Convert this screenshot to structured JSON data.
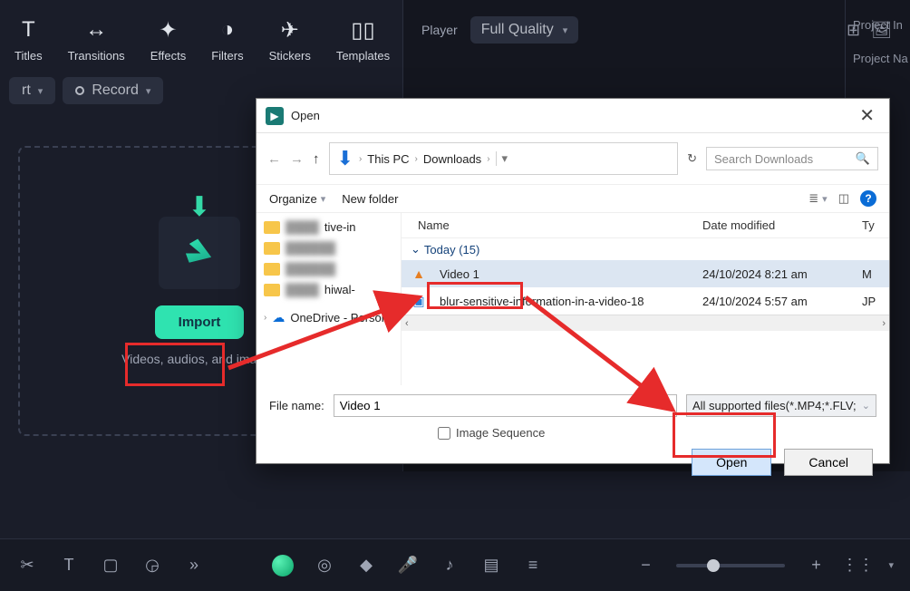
{
  "toolbar": {
    "items": [
      {
        "label": "Titles",
        "icon": "T"
      },
      {
        "label": "Transitions",
        "icon": "↔"
      },
      {
        "label": "Effects",
        "icon": "✦"
      },
      {
        "label": "Filters",
        "icon": "◑"
      },
      {
        "label": "Stickers",
        "icon": "✈"
      },
      {
        "label": "Templates",
        "icon": "▯▯"
      }
    ]
  },
  "recordbar": {
    "dropdown1": "rt",
    "record_label": "Record"
  },
  "dropzone": {
    "import_label": "Import",
    "hint": "Videos, audios, and images"
  },
  "preview": {
    "player_label": "Player",
    "quality": "Full Quality"
  },
  "sideprops": {
    "row1": "Project In",
    "row2": "Project Na"
  },
  "dialog": {
    "title": "Open",
    "crumbs": [
      "This PC",
      "Downloads"
    ],
    "search_placeholder": "Search Downloads",
    "organize": "Organize",
    "new_folder": "New folder",
    "col_name": "Name",
    "col_date": "Date modified",
    "col_type": "Ty",
    "tree": {
      "item1": "tive-in",
      "item5": "hiwal-",
      "onedrive": "OneDrive - Person"
    },
    "group": "Today (15)",
    "files": [
      {
        "icon": "vlc",
        "name": "Video 1",
        "date": "24/10/2024 8:21 am",
        "type": "M"
      },
      {
        "icon": "jpg",
        "name": "blur-sensitive-information-in-a-video-18",
        "date": "24/10/2024 5:57 am",
        "type": "JP"
      }
    ],
    "filename_label": "File name:",
    "filename_value": "Video 1",
    "filetype": "All supported files(*.MP4;*.FLV;",
    "image_sequence": "Image Sequence",
    "open_btn": "Open",
    "cancel_btn": "Cancel"
  }
}
